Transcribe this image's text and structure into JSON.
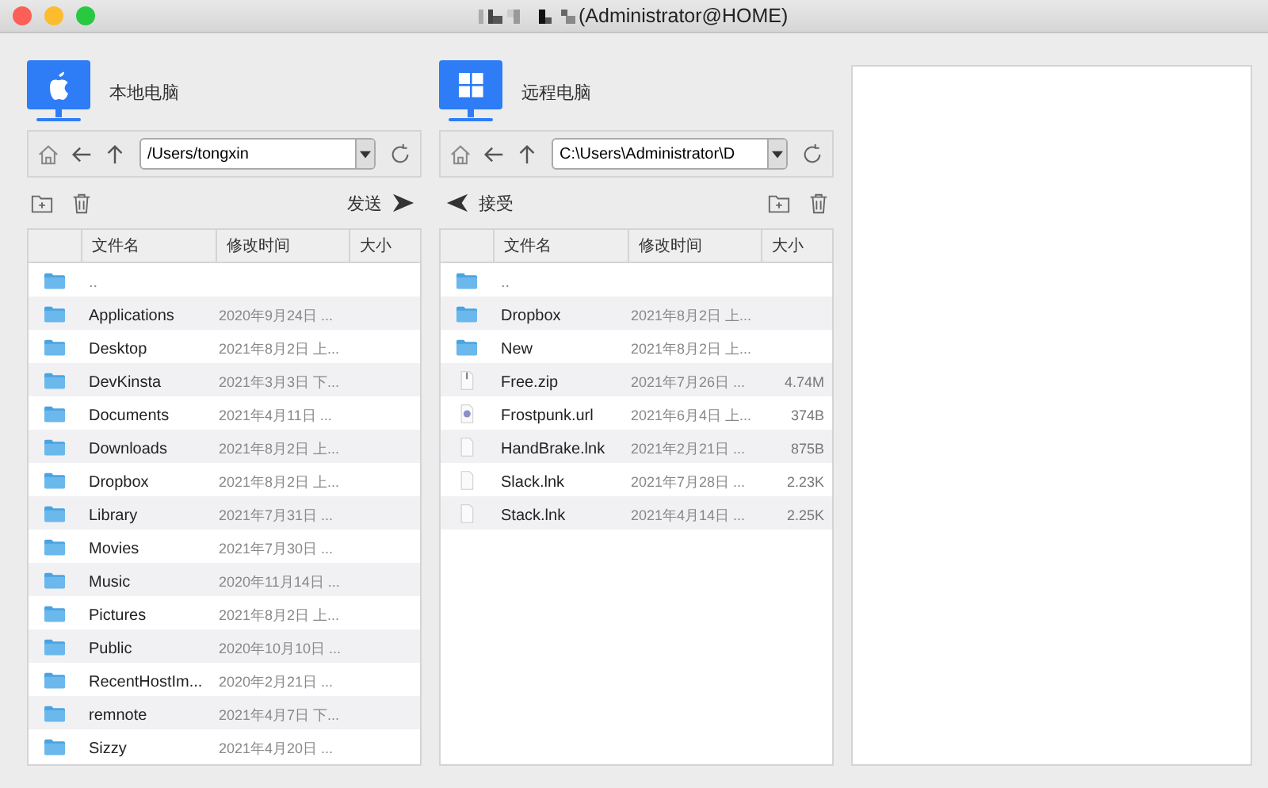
{
  "window": {
    "title": "(Administrator@HOME)"
  },
  "panels": [
    {
      "kind": "mac",
      "label": "本地电脑",
      "path": "/Users/tongxin",
      "transfer": {
        "label": "发送",
        "kind": "send"
      },
      "columns": [
        "文件名",
        "修改时间",
        "大小"
      ],
      "rows": [
        {
          "kind": "folder",
          "name": "..",
          "modified": "",
          "size": ""
        },
        {
          "kind": "folder",
          "name": "Applications",
          "modified": "2020年9月24日 ...",
          "size": ""
        },
        {
          "kind": "folder",
          "name": "Desktop",
          "modified": "2021年8月2日 上...",
          "size": ""
        },
        {
          "kind": "folder",
          "name": "DevKinsta",
          "modified": "2021年3月3日 下...",
          "size": ""
        },
        {
          "kind": "folder",
          "name": "Documents",
          "modified": "2021年4月11日 ...",
          "size": ""
        },
        {
          "kind": "folder",
          "name": "Downloads",
          "modified": "2021年8月2日 上...",
          "size": ""
        },
        {
          "kind": "folder",
          "name": "Dropbox",
          "modified": "2021年8月2日 上...",
          "size": ""
        },
        {
          "kind": "folder",
          "name": "Library",
          "modified": "2021年7月31日 ...",
          "size": ""
        },
        {
          "kind": "folder",
          "name": "Movies",
          "modified": "2021年7月30日 ...",
          "size": ""
        },
        {
          "kind": "folder",
          "name": "Music",
          "modified": "2020年11月14日 ...",
          "size": ""
        },
        {
          "kind": "folder",
          "name": "Pictures",
          "modified": "2021年8月2日 上...",
          "size": ""
        },
        {
          "kind": "folder",
          "name": "Public",
          "modified": "2020年10月10日 ...",
          "size": ""
        },
        {
          "kind": "folder",
          "name": "RecentHostIm...",
          "modified": "2020年2月21日 ...",
          "size": ""
        },
        {
          "kind": "folder",
          "name": "remnote",
          "modified": "2021年4月7日 下...",
          "size": ""
        },
        {
          "kind": "folder",
          "name": "Sizzy",
          "modified": "2021年4月20日 ...",
          "size": ""
        }
      ]
    },
    {
      "kind": "windows",
      "label": "远程电脑",
      "path": "C:\\Users\\Administrator\\D",
      "transfer": {
        "label": "接受",
        "kind": "receive"
      },
      "columns": [
        "文件名",
        "修改时间",
        "大小"
      ],
      "rows": [
        {
          "kind": "folder",
          "name": "..",
          "modified": "",
          "size": ""
        },
        {
          "kind": "folder",
          "name": "Dropbox",
          "modified": "2021年8月2日 上...",
          "size": ""
        },
        {
          "kind": "folder",
          "name": "New",
          "modified": "2021年8月2日 上...",
          "size": ""
        },
        {
          "kind": "zip",
          "name": "Free.zip",
          "modified": "2021年7月26日 ...",
          "size": "4.74M"
        },
        {
          "kind": "url",
          "name": "Frostpunk.url",
          "modified": "2021年6月4日 上...",
          "size": "374B"
        },
        {
          "kind": "file",
          "name": "HandBrake.lnk",
          "modified": "2021年2月21日 ...",
          "size": "875B"
        },
        {
          "kind": "file",
          "name": "Slack.lnk",
          "modified": "2021年7月28日 ...",
          "size": "2.23K"
        },
        {
          "kind": "file",
          "name": "Stack.lnk",
          "modified": "2021年4月14日 ...",
          "size": "2.25K"
        }
      ]
    }
  ]
}
